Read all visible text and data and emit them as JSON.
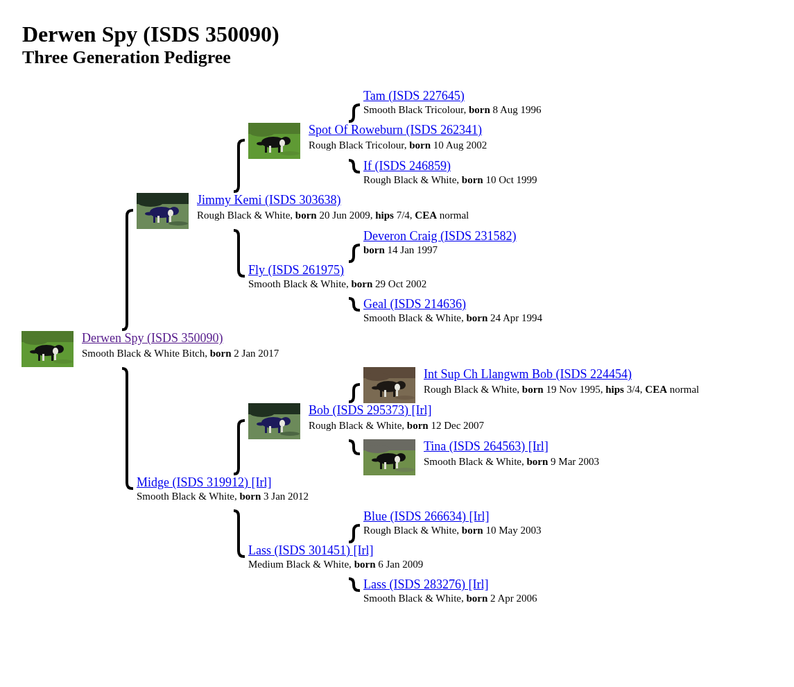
{
  "title": "Derwen Spy (ISDS 350090)",
  "subtitle": "Three Generation Pedigree",
  "pedigree": {
    "name": "Derwen Spy (ISDS 350090)",
    "visited": true,
    "details": "Smooth Black & White Bitch, **born** 2 Jan 2017",
    "children": [
      {
        "name": "Jimmy Kemi (ISDS 303638)",
        "visited": false,
        "details": "Rough Black & White, **born** 20 Jun 2009, **hips** 7/4, **CEA** normal",
        "children": [
          {
            "name": "Spot Of Roweburn (ISDS 262341)",
            "visited": false,
            "details": "Rough Black Tricolour, **born** 10 Aug 2002",
            "children": [
              {
                "name": "Tam (ISDS 227645)",
                "visited": false,
                "details": "Smooth Black Tricolour, **born** 8 Aug 1996"
              },
              {
                "name": "If (ISDS 246859)",
                "visited": false,
                "details": "Rough Black & White, **born** 10 Oct 1999"
              }
            ]
          },
          {
            "name": "Fly (ISDS 261975)",
            "visited": false,
            "details": "Smooth Black & White, **born** 29 Oct 2002",
            "children": [
              {
                "name": "Deveron Craig (ISDS 231582)",
                "visited": false,
                "details": "**born** 14 Jan 1997"
              },
              {
                "name": "Geal (ISDS 214636)",
                "visited": false,
                "details": "Smooth Black & White, **born** 24 Apr 1994"
              }
            ]
          }
        ]
      },
      {
        "name": "Midge (ISDS 319912) [Irl]",
        "visited": false,
        "details": "Smooth Black & White, **born** 3 Jan 2012",
        "children": [
          {
            "name": "Bob (ISDS 295373) [Irl]",
            "visited": false,
            "details": "Rough Black & White, **born** 12 Dec 2007",
            "children": [
              {
                "name": "Int Sup Ch Llangwm Bob (ISDS 224454)",
                "visited": false,
                "details": "Rough Black & White, **born** 19 Nov 1995, **hips** 3/4, **CEA** normal"
              },
              {
                "name": "Tina (ISDS 264563) [Irl]",
                "visited": false,
                "details": "Smooth Black & White, **born** 9 Mar 2003"
              }
            ]
          },
          {
            "name": "Lass (ISDS 301451) [Irl]",
            "visited": false,
            "details": "Medium Black & White, **born** 6 Jan 2009",
            "children": [
              {
                "name": "Blue (ISDS 266634) [Irl]",
                "visited": false,
                "details": "Rough Black & White, **born** 10 May 2003"
              },
              {
                "name": "Lass (ISDS 283276) [Irl]",
                "visited": false,
                "details": "Smooth Black & White, **born** 2 Apr 2006"
              }
            ]
          }
        ]
      }
    ]
  }
}
